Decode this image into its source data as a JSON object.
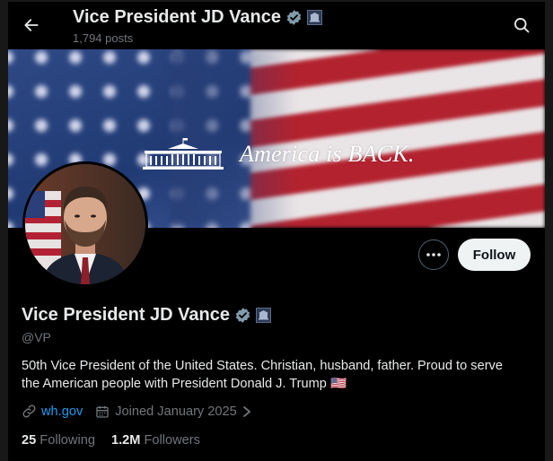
{
  "header": {
    "title": "Vice President JD Vance",
    "posts_count": "1,794 posts"
  },
  "banner": {
    "slogan": "America is BACK."
  },
  "actions": {
    "follow_label": "Follow"
  },
  "profile": {
    "display_name": "Vice President JD Vance",
    "handle": "@VP",
    "bio": "50th Vice President of the United States. Christian, husband, father. Proud to serve the American people with President Donald J. Trump 🇺🇸",
    "website": "wh.gov",
    "joined": "Joined January 2025",
    "following_count": "25",
    "following_label": "Following",
    "followers_count": "1.2M",
    "followers_label": "Followers"
  },
  "icons": {
    "back": "arrow-left-icon",
    "search": "search-icon",
    "verified": "verified-badge-icon",
    "affiliation": "government-affiliation-icon",
    "more": "more-options-icon",
    "link": "link-icon",
    "calendar": "calendar-icon",
    "chevron": "chevron-right-icon"
  },
  "colors": {
    "background": "#000000",
    "text": "#e7e9ea",
    "muted": "#71767b",
    "link": "#1d9bf0",
    "follow_button_bg": "#eff3f4"
  }
}
